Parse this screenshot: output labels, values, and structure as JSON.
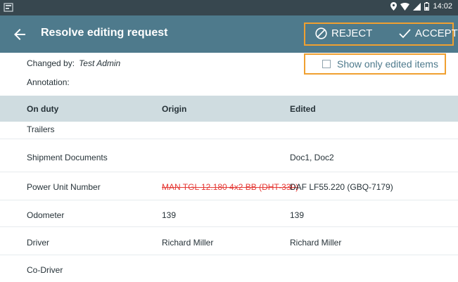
{
  "status_bar": {
    "time": "14:02"
  },
  "header": {
    "title": "Resolve editing request",
    "reject_label": "REJECT",
    "accept_label": "ACCEPT"
  },
  "request": {
    "changed_by_label": "Changed by:",
    "changed_by_value": "Test Admin",
    "annotation_label": "Annotation:"
  },
  "filter": {
    "show_only_edited_label": "Show only edited items",
    "checked": false
  },
  "table": {
    "columns": [
      "On duty",
      "Origin",
      "Edited"
    ],
    "rows": [
      {
        "name": "Trailers",
        "origin": "",
        "edited": ""
      },
      {
        "name": "Shipment Documents",
        "origin": "",
        "edited": "Doc1, Doc2"
      },
      {
        "name": "Power Unit Number",
        "origin": "MAN TGL 12.180 4x2 BB (DHT-330)",
        "edited": "DAF LF55.220 (GBQ-7179)"
      },
      {
        "name": "Odometer",
        "origin": "139",
        "edited": "139"
      },
      {
        "name": "Driver",
        "origin": "Richard  Miller",
        "edited": "Richard  Miller"
      },
      {
        "name": "Co-Driver",
        "origin": "",
        "edited": ""
      }
    ]
  },
  "colors": {
    "status_bar": "#37474f",
    "app_bar": "#4e7a8c",
    "highlight_border": "#f0a030",
    "table_header": "#cfdce0",
    "changed_origin": "#e53935"
  }
}
